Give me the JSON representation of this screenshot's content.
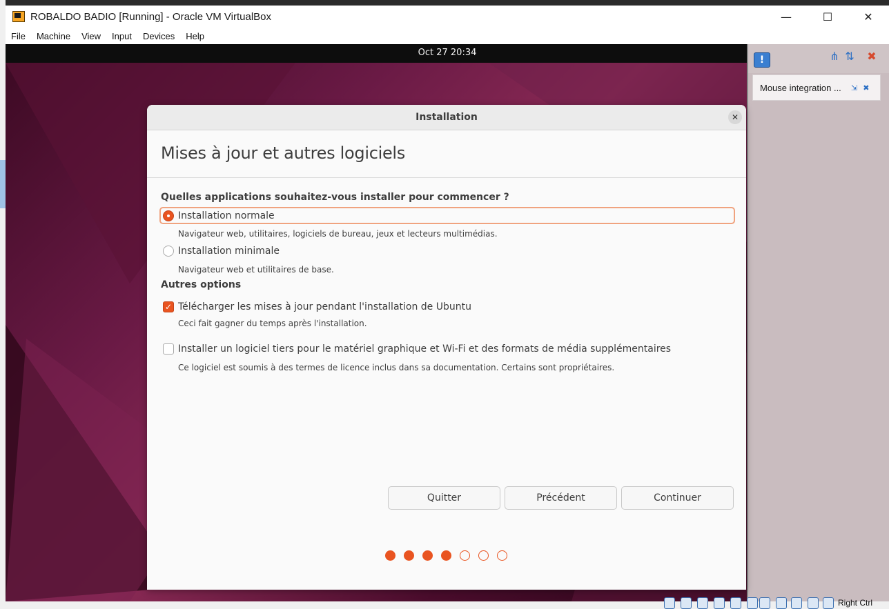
{
  "host": {
    "window_title": "ROBALDO BADIO [Running] - Oracle VM VirtualBox",
    "controls": {
      "minimize": "—",
      "maximize": "☐",
      "close": "✕"
    },
    "menu": [
      "File",
      "Machine",
      "View",
      "Input",
      "Devices",
      "Help"
    ],
    "host_key": "Right Ctrl"
  },
  "guest": {
    "clock": "Oct 27  20:34"
  },
  "panel": {
    "notification": "Mouse integration ..."
  },
  "dialog": {
    "title": "Installation",
    "close_glyph": "✕",
    "heading": "Mises à jour et autres logiciels",
    "question": "Quelles applications souhaitez-vous installer pour commencer ?",
    "options": [
      {
        "label": "Installation normale",
        "description": "Navigateur web, utilitaires, logiciels de bureau, jeux et lecteurs multimédias.",
        "selected": true
      },
      {
        "label": "Installation minimale",
        "description": "Navigateur web et utilitaires de base.",
        "selected": false
      }
    ],
    "other_options_label": "Autres options",
    "checkboxes": [
      {
        "label": "Télécharger les mises à jour pendant l'installation de Ubuntu",
        "description": "Ceci fait gagner du temps après l'installation.",
        "checked": true
      },
      {
        "label": "Installer un logiciel tiers pour le matériel graphique et Wi-Fi et des formats de média supplémentaires",
        "description": "Ce logiciel est soumis à des termes de licence inclus dans sa documentation. Certains sont propriétaires.",
        "checked": false
      }
    ],
    "buttons": {
      "quit": "Quitter",
      "previous": "Précédent",
      "continue": "Continuer"
    },
    "progress": {
      "total_steps": 7,
      "completed_steps": 4
    }
  },
  "colors": {
    "accent": "#e95420",
    "dialog_bg": "#fafafa",
    "text": "#3d3d3d"
  }
}
